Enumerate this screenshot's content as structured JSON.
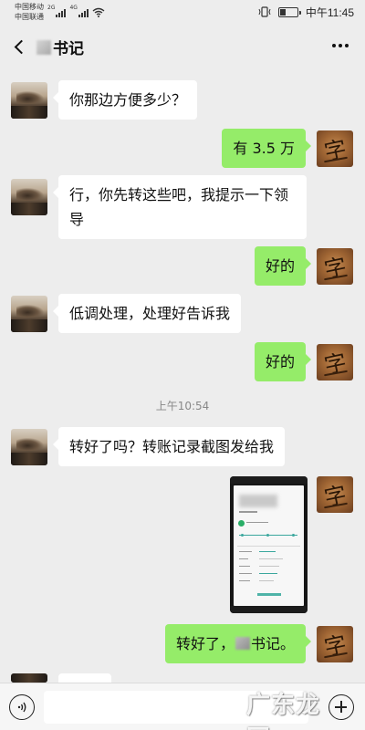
{
  "status_bar": {
    "carrier_1": "中国移动",
    "carrier_2": "中国联通",
    "network_type_1": "2G",
    "network_type_2": "4G",
    "time": "中午11:45",
    "battery_level": 0.35,
    "icons": [
      "signal-icon",
      "wifi-icon",
      "vibrate-icon",
      "battery-icon"
    ]
  },
  "header": {
    "title": "书记",
    "back_icon": "chevron-left-icon",
    "more_icon": "ellipsis-icon"
  },
  "messages": [
    {
      "from": "other",
      "text": "你那边方便多少？"
    },
    {
      "from": "me",
      "text": "有 3.5 万"
    },
    {
      "from": "other",
      "text_line_1": "行，你先转这些吧，我提示一下领",
      "text_line_2": "导"
    },
    {
      "from": "me",
      "text": "好的"
    },
    {
      "from": "other",
      "text": "低调处理，处理好告诉我"
    },
    {
      "from": "me",
      "text": "好的"
    },
    {
      "from": "other",
      "text": "转好了吗？转账记录截图发给我"
    },
    {
      "from": "me",
      "type": "image"
    },
    {
      "from": "me",
      "text_prefix": "转好了，",
      "text_suffix": "书记。"
    }
  ],
  "time_separator": "上午10:54",
  "input_bar": {
    "placeholder": "",
    "voice_icon": "voice-icon",
    "plus_icon": "plus-icon"
  },
  "watermark": "广东龙网",
  "colors": {
    "chat_background": "#ededed",
    "incoming_bubble": "#ffffff",
    "outgoing_bubble": "#95ec69"
  }
}
